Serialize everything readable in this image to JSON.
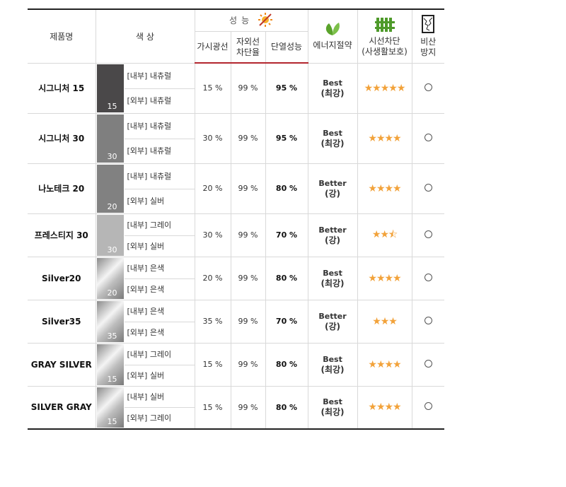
{
  "header": {
    "product": "제품명",
    "color": "색 상",
    "performance": "성능",
    "visible_light": [
      "가시광선"
    ],
    "uv_block": [
      "자외선",
      "차단율"
    ],
    "insulation": [
      "단열성능"
    ],
    "energy": [
      "에너지절약"
    ],
    "privacy": [
      "시선차단",
      "(사생활보호)"
    ],
    "shatter": [
      "비산",
      "방지"
    ],
    "icons": {
      "performance": "sun-heat-icon",
      "energy": "leaf-icon",
      "privacy": "fence-icon",
      "shatter": "shattered-glass-icon"
    }
  },
  "rows": [
    {
      "name": "시그니처 15",
      "swatch": "15",
      "inner": "[내부] 내츄럴",
      "outer": "[외부] 내츄럴",
      "visible": "15 %",
      "uv": "99 %",
      "insulation": "95 %",
      "energy_rating": "Best",
      "energy_level": "(최강)",
      "privacy_stars": 5,
      "shatter": "○",
      "swatch_color": "#4a4849"
    },
    {
      "name": "시그니처 30",
      "swatch": "30",
      "inner": "[내부] 내츄럴",
      "outer": "[외부] 내츄럴",
      "visible": "30 %",
      "uv": "99 %",
      "insulation": "95 %",
      "energy_rating": "Best",
      "energy_level": "(최강)",
      "privacy_stars": 4,
      "shatter": "○",
      "swatch_color": "#7f7f7f"
    },
    {
      "name": "나노테크 20",
      "swatch": "20",
      "inner": "[내부] 내츄럴",
      "outer": "[외부] 실버",
      "visible": "20 %",
      "uv": "99 %",
      "insulation": "80 %",
      "energy_rating": "Better",
      "energy_level": "(강)",
      "privacy_stars": 4,
      "shatter": "○",
      "swatch_color": "#818181"
    },
    {
      "name": "프레스티지 30",
      "swatch": "30",
      "inner": "[내부] 그레이",
      "outer": "[외부] 실버",
      "visible": "30 %",
      "uv": "99 %",
      "insulation": "70 %",
      "energy_rating": "Better",
      "energy_level": "(강)",
      "privacy_stars": 2.5,
      "shatter": "○",
      "swatch_color": "#b6b6b6"
    },
    {
      "name": "Silver20",
      "swatch": "20",
      "inner": "[내부] 은색",
      "outer": "[외부] 은색",
      "visible": "20 %",
      "uv": "99 %",
      "insulation": "80 %",
      "energy_rating": "Best",
      "energy_level": "(최강)",
      "privacy_stars": 4,
      "shatter": "○",
      "swatch_color": "silver"
    },
    {
      "name": "Silver35",
      "swatch": "35",
      "inner": "[내부] 은색",
      "outer": "[외부] 은색",
      "visible": "35 %",
      "uv": "99 %",
      "insulation": "70 %",
      "energy_rating": "Better",
      "energy_level": "(강)",
      "privacy_stars": 3,
      "shatter": "○",
      "swatch_color": "silver"
    },
    {
      "name": "GRAY SILVER",
      "swatch": "15",
      "inner": "[내부] 그레이",
      "outer": "[외부] 실버",
      "visible": "15 %",
      "uv": "99 %",
      "insulation": "80 %",
      "energy_rating": "Best",
      "energy_level": "(최강)",
      "privacy_stars": 4,
      "shatter": "○",
      "swatch_color": "silver"
    },
    {
      "name": "SILVER GRAY",
      "swatch": "15",
      "inner": "[내부] 실버",
      "outer": "[외부] 그레이",
      "visible": "15 %",
      "uv": "99 %",
      "insulation": "80 %",
      "energy_rating": "Best",
      "energy_level": "(최강)",
      "privacy_stars": 4,
      "shatter": "○",
      "swatch_color": "silver"
    }
  ]
}
